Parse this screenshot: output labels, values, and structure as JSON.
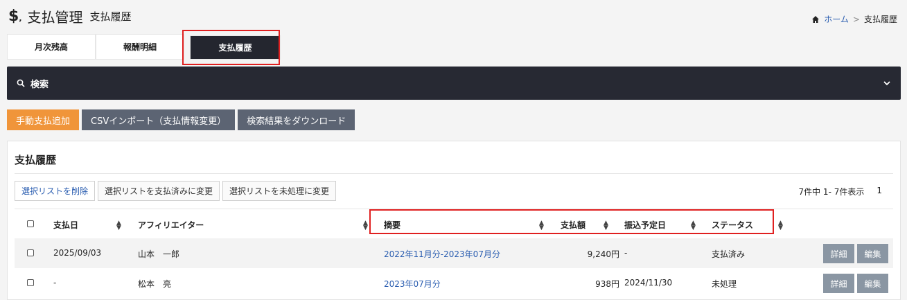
{
  "header": {
    "icon": "dollar-icon",
    "title": "支払管理",
    "subtitle": "支払履歴"
  },
  "breadcrumb": {
    "home": "ホーム",
    "separator": ">",
    "current": "支払履歴"
  },
  "tabs": [
    {
      "label": "月次残高"
    },
    {
      "label": "報酬明細"
    },
    {
      "label": "支払履歴"
    }
  ],
  "search": {
    "label": "検索"
  },
  "actions": {
    "manual_add": "手動支払追加",
    "csv_import": "CSVインポート（支払情報変更）",
    "download": "検索結果をダウンロード"
  },
  "panel": {
    "title": "支払履歴",
    "list_buttons": [
      "選択リストを削除",
      "選択リストを支払済みに変更",
      "選択リストを未処理に変更"
    ],
    "pager": {
      "summary": "7件中 1- 7件表示",
      "page": "1"
    },
    "columns": [
      "支払日",
      "アフィリエイター",
      "摘要",
      "支払額",
      "振込予定日",
      "ステータス"
    ],
    "rows": [
      {
        "date": "2025/09/03",
        "affiliator": "山本　一郎",
        "summary": "2022年11月分-2023年07月分",
        "amount": "9,240円",
        "scheduled": "-",
        "status": "支払済み"
      },
      {
        "date": "-",
        "affiliator": "松本　亮",
        "summary": "2023年07月分",
        "amount": "938円",
        "scheduled": "2024/11/30",
        "status": "未処理"
      }
    ],
    "row_buttons": {
      "detail": "詳細",
      "edit": "編集"
    }
  },
  "colors": {
    "accent_orange": "#f0953a",
    "dark_bar": "#272933",
    "gray_button": "#5c6473",
    "highlight_red": "#e02020",
    "link_blue": "#2a5db0"
  }
}
